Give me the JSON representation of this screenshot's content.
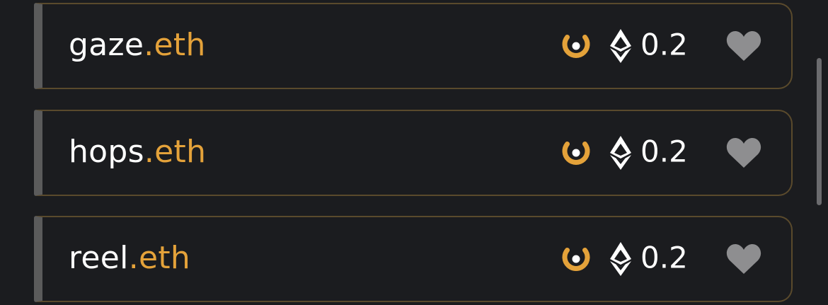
{
  "domains": [
    {
      "name": "gaze",
      "tld": ".eth",
      "price": "0.2",
      "badge_icon": "gold-ring-badge-icon",
      "currency_icon": "ethereum-icon",
      "favorite_icon": "heart-icon"
    },
    {
      "name": "hops",
      "tld": ".eth",
      "price": "0.2",
      "badge_icon": "gold-ring-badge-icon",
      "currency_icon": "ethereum-icon",
      "favorite_icon": "heart-icon"
    },
    {
      "name": "reel",
      "tld": ".eth",
      "price": "0.2",
      "badge_icon": "gold-ring-badge-icon",
      "currency_icon": "ethereum-icon",
      "favorite_icon": "heart-icon"
    }
  ],
  "colors": {
    "background": "#1b1c1f",
    "accent": "#e4a23a",
    "card_border": "#5a4a2c",
    "card_left_bar": "#5b5b5b",
    "text": "#ffffff",
    "heart": "#8e8e90",
    "scrollbar_thumb": "#6b6b6e"
  }
}
